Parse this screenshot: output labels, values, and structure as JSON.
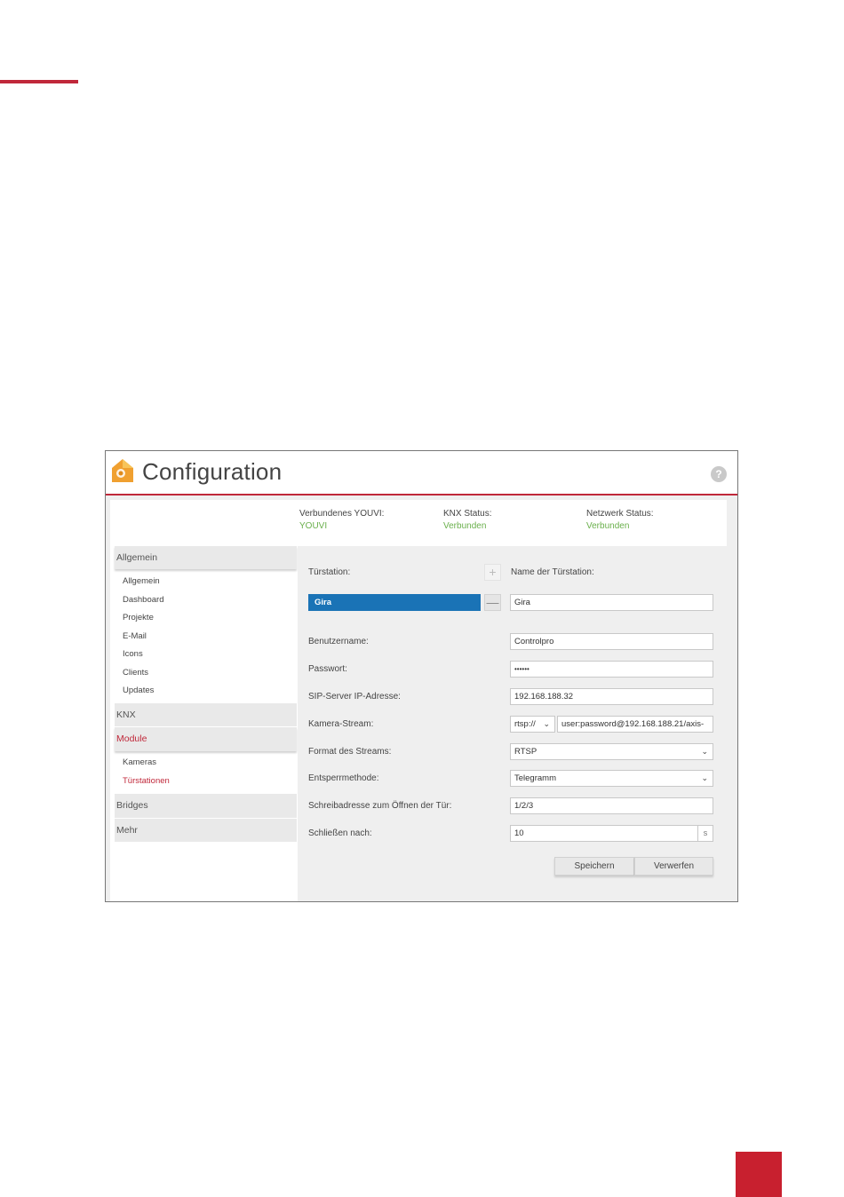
{
  "app": {
    "title": "Configuration",
    "help_icon": "question-icon",
    "help_glyph": "?"
  },
  "status": {
    "youvi": {
      "label": "Verbundenes YOUVI:",
      "value": "YOUVI"
    },
    "knx": {
      "label": "KNX Status:",
      "value": "Verbunden"
    },
    "network": {
      "label": "Netzwerk Status:",
      "value": "Verbunden"
    }
  },
  "sidebar": {
    "groups": {
      "allgemein": {
        "label": "Allgemein",
        "items": [
          "Allgemein",
          "Dashboard",
          "Projekte",
          "E-Mail",
          "Icons",
          "Clients",
          "Updates"
        ]
      },
      "knx": {
        "label": "KNX"
      },
      "module": {
        "label": "Module",
        "items": [
          "Kameras",
          "Türstationen"
        ]
      },
      "bridges": {
        "label": "Bridges"
      },
      "mehr": {
        "label": "Mehr"
      }
    }
  },
  "form": {
    "door_station_label": "Türstation:",
    "door_station_selected": "Gira",
    "add_glyph": "+",
    "remove_glyph": "—",
    "name_label": "Name der Türstation:",
    "name_value": "Gira",
    "username_label": "Benutzername:",
    "username_value": "Controlpro",
    "password_label": "Passwort:",
    "password_value": "••••••",
    "sip_label": "SIP-Server IP-Adresse:",
    "sip_value": "192.168.188.32",
    "camera_label": "Kamera-Stream:",
    "camera_protocol": "rtsp://",
    "camera_value": "user:password@192.168.188.21/axis-",
    "format_label": "Format des Streams:",
    "format_value": "RTSP",
    "unlock_label": "Entsperrmethode:",
    "unlock_value": "Telegramm",
    "address_label": "Schreibadresse zum Öffnen der Tür:",
    "address_value": "1/2/3",
    "close_label": "Schließen nach:",
    "close_value": "10",
    "close_unit": "s",
    "chevron": "⌄"
  },
  "buttons": {
    "save": "Speichern",
    "discard": "Verwerfen"
  },
  "colors": {
    "accent": "#c0283a",
    "selected": "#1a73b6",
    "status_ok": "#6ab04c",
    "badge": "#c8202f"
  }
}
